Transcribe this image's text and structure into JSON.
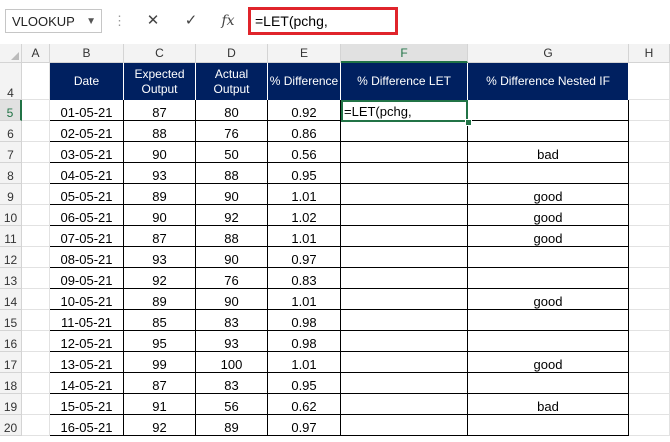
{
  "formula_bar": {
    "name_box": "VLOOKUP",
    "cancel_icon": "✕",
    "enter_icon": "✓",
    "fx_label": "fx",
    "formula": "=LET(pchg,"
  },
  "columns": [
    "A",
    "B",
    "C",
    "D",
    "E",
    "F",
    "G",
    "H"
  ],
  "active_column": "F",
  "active_row": "5",
  "table_header": {
    "row": "4",
    "date": "Date",
    "expected": "Expected Output",
    "actual": "Actual Output",
    "pct_diff": "% Difference",
    "pct_diff_let": "% Difference LET",
    "pct_diff_nested_if": "% Difference Nested IF"
  },
  "active_cell_text": "=LET(pchg,",
  "rows": [
    {
      "row": "5",
      "date": "01-05-21",
      "expected": "87",
      "actual": "80",
      "pct": "0.92",
      "nested_if": ""
    },
    {
      "row": "6",
      "date": "02-05-21",
      "expected": "88",
      "actual": "76",
      "pct": "0.86",
      "nested_if": ""
    },
    {
      "row": "7",
      "date": "03-05-21",
      "expected": "90",
      "actual": "50",
      "pct": "0.56",
      "nested_if": "bad"
    },
    {
      "row": "8",
      "date": "04-05-21",
      "expected": "93",
      "actual": "88",
      "pct": "0.95",
      "nested_if": ""
    },
    {
      "row": "9",
      "date": "05-05-21",
      "expected": "89",
      "actual": "90",
      "pct": "1.01",
      "nested_if": "good"
    },
    {
      "row": "10",
      "date": "06-05-21",
      "expected": "90",
      "actual": "92",
      "pct": "1.02",
      "nested_if": "good"
    },
    {
      "row": "11",
      "date": "07-05-21",
      "expected": "87",
      "actual": "88",
      "pct": "1.01",
      "nested_if": "good"
    },
    {
      "row": "12",
      "date": "08-05-21",
      "expected": "93",
      "actual": "90",
      "pct": "0.97",
      "nested_if": ""
    },
    {
      "row": "13",
      "date": "09-05-21",
      "expected": "92",
      "actual": "76",
      "pct": "0.83",
      "nested_if": ""
    },
    {
      "row": "14",
      "date": "10-05-21",
      "expected": "89",
      "actual": "90",
      "pct": "1.01",
      "nested_if": "good"
    },
    {
      "row": "15",
      "date": "11-05-21",
      "expected": "85",
      "actual": "83",
      "pct": "0.98",
      "nested_if": ""
    },
    {
      "row": "16",
      "date": "12-05-21",
      "expected": "95",
      "actual": "93",
      "pct": "0.98",
      "nested_if": ""
    },
    {
      "row": "17",
      "date": "13-05-21",
      "expected": "99",
      "actual": "100",
      "pct": "1.01",
      "nested_if": "good"
    },
    {
      "row": "18",
      "date": "14-05-21",
      "expected": "87",
      "actual": "83",
      "pct": "0.95",
      "nested_if": ""
    },
    {
      "row": "19",
      "date": "15-05-21",
      "expected": "91",
      "actual": "56",
      "pct": "0.62",
      "nested_if": "bad"
    },
    {
      "row": "20",
      "date": "16-05-21",
      "expected": "92",
      "actual": "89",
      "pct": "0.97",
      "nested_if": ""
    }
  ],
  "colors": {
    "header_fill": "#002060",
    "accent": "#217346",
    "highlight": "#e0242b"
  }
}
